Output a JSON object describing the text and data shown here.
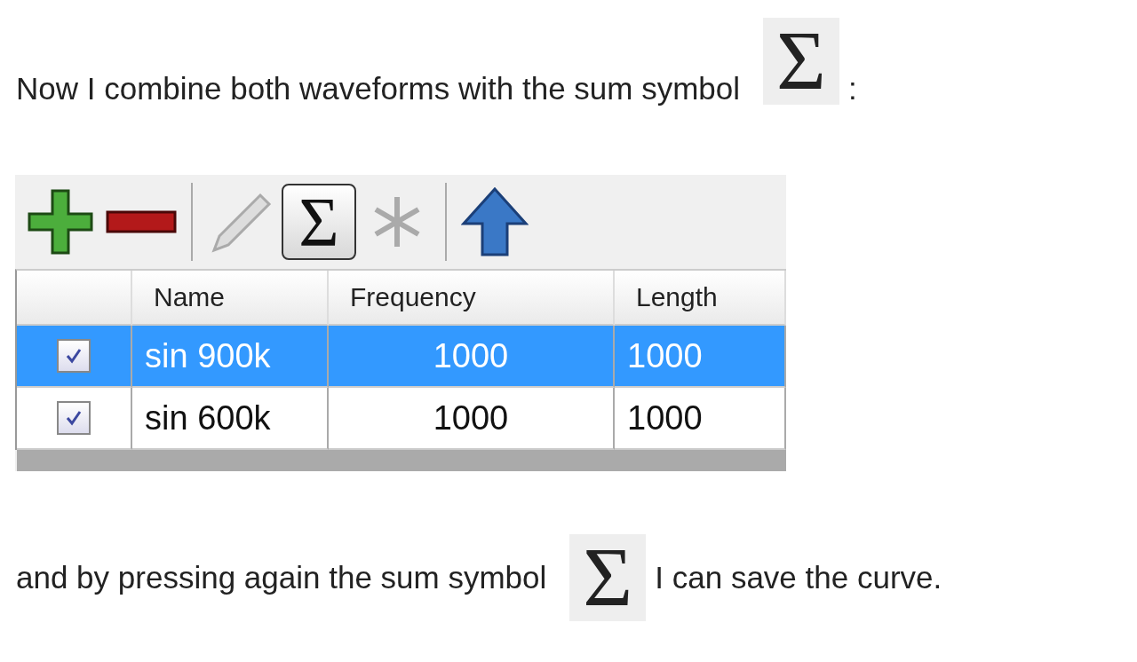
{
  "intro": {
    "text": "Now I combine both waveforms with the sum symbol",
    "symbol": "Σ",
    "after": ":"
  },
  "toolbar": [
    {
      "kind": "add",
      "disabled": false,
      "pressed": false
    },
    {
      "kind": "remove",
      "disabled": false,
      "pressed": false
    },
    {
      "kind": "separator"
    },
    {
      "kind": "edit",
      "disabled": true,
      "pressed": false
    },
    {
      "kind": "sum",
      "label": "Σ",
      "disabled": false,
      "pressed": true
    },
    {
      "kind": "star",
      "disabled": true,
      "pressed": false
    },
    {
      "kind": "separator"
    },
    {
      "kind": "up",
      "disabled": false,
      "pressed": false
    }
  ],
  "table": {
    "columns": [
      "Name",
      "Frequency",
      "Length"
    ],
    "rows": [
      {
        "checked": true,
        "selected": true,
        "name": "sin 900k",
        "frequency": "1000",
        "length": "1000"
      },
      {
        "checked": true,
        "selected": false,
        "name": "sin 600k",
        "frequency": "1000",
        "length": "1000"
      }
    ]
  },
  "outro": {
    "before": "and by pressing again the sum symbol",
    "symbol": "Σ",
    "after": "I can save the curve."
  }
}
